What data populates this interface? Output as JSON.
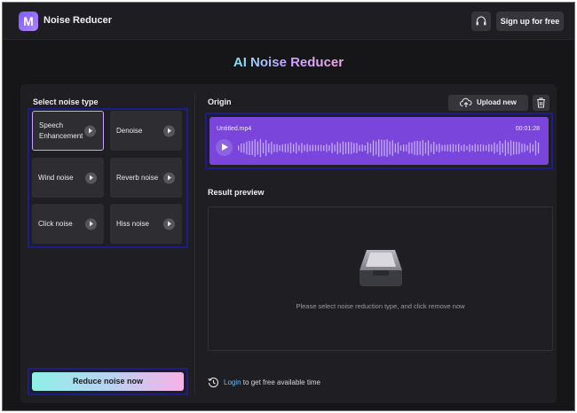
{
  "header": {
    "logo_letter": "M",
    "app_title": "Noise Reducer",
    "signup_label": "Sign up for free",
    "support_icon": "headset-icon"
  },
  "hero": {
    "title": "AI Noise Reducer"
  },
  "noise_panel": {
    "section_label": "Select noise type",
    "selected": "Speech Enhancement",
    "types": [
      {
        "label": "Speech Enhancement"
      },
      {
        "label": "Denoise"
      },
      {
        "label": "Wind noise"
      },
      {
        "label": "Reverb noise"
      },
      {
        "label": "Click noise"
      },
      {
        "label": "Hiss noise"
      }
    ],
    "reduce_label": "Reduce noise now"
  },
  "origin": {
    "section_label": "Origin",
    "upload_label": "Upload new",
    "file_name": "Untitled.mp4",
    "duration": "00:01:28"
  },
  "result": {
    "section_label": "Result preview",
    "hint": "Please select noise reduction type, and click remove now"
  },
  "login": {
    "link_label": "Login",
    "rest_text": " to get free available time"
  },
  "colors": {
    "background": "#161619",
    "panel": "#1f1f23",
    "audio_card": "#7a45db",
    "highlight_border": "#1c1c8a",
    "link": "#6ab7ff"
  }
}
